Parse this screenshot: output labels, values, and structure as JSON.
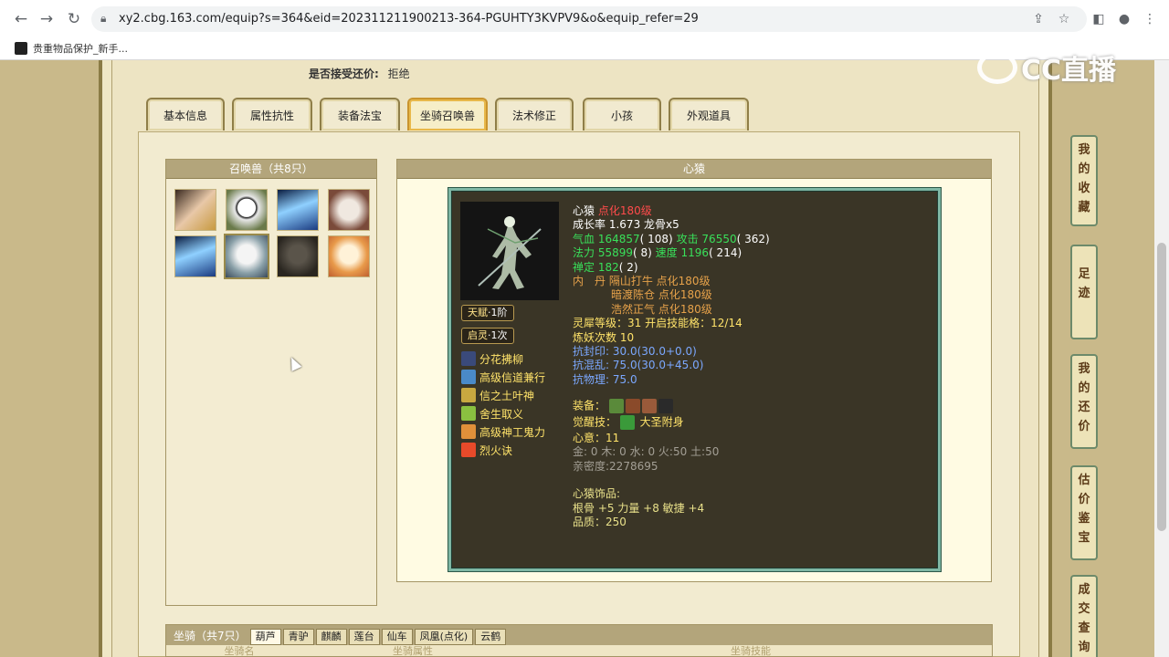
{
  "browser": {
    "url": "xy2.cbg.163.com/equip?s=364&eid=202311211900213-364-PGUHTY3KVPV9&o&equip_refer=29",
    "bookmark": "贵重物品保护_新手..."
  },
  "header": {
    "bargain_label": "是否接受还价:",
    "bargain_value": "拒绝"
  },
  "tabs": [
    "基本信息",
    "属性抗性",
    "装备法宝",
    "坐骑召唤兽",
    "法术修正",
    "小孩",
    "外观道具"
  ],
  "pets": {
    "title": "召唤兽（共8只）"
  },
  "detail": {
    "title": "心猿",
    "name": "心猿",
    "name_tag": "点化180级",
    "growth_label": "成长率",
    "growth_value": "1.673",
    "dragon": "龙骨x5",
    "hp_label": "气血",
    "hp_value": "164857",
    "hp_extra": "( 108)",
    "atk_label": "攻击",
    "atk_value": "76550",
    "atk_extra": "( 362)",
    "mp_label": "法力",
    "mp_value": "55899",
    "mp_extra": "( 8)",
    "spd_label": "速度",
    "spd_value": "1196",
    "spd_extra": "( 214)",
    "zen_label": "禅定",
    "zen_value": "182",
    "zen_extra": "( 2)",
    "neidan_label": "内　丹",
    "neidan": [
      "隔山打牛 点化180级",
      "暗渡陈仓 点化180级",
      "浩然正气 点化180级"
    ],
    "soul_label": "灵犀等级：",
    "soul_value": "31",
    "soul_skill_label": "开启技能格：",
    "soul_skill_value": "12/14",
    "refine_label": "炼妖次数",
    "refine_value": "10",
    "res_seal_label": "抗封印:",
    "res_seal_value": "30.0(30.0+0.0)",
    "res_chaos_label": "抗混乱:",
    "res_chaos_value": "75.0(30.0+45.0)",
    "res_phys_label": "抗物理:",
    "res_phys_value": "75.0",
    "equip_label": "装备：",
    "awaken_label": "觉醒技：",
    "awaken_value": "大圣附身",
    "mind_label": "心意：",
    "mind_value": "11",
    "elements": "金: 0 木: 0 水: 0 火:50 土:50",
    "intimacy": "亲密度:2278695",
    "ornament_title": "心猿饰品:",
    "ornament_stats": "根骨 +5 力量 +8 敏捷 +4",
    "ornament_quality": "品质：250"
  },
  "badges": [
    {
      "label": "天赋",
      "value": "·1阶"
    },
    {
      "label": "启灵",
      "value": "·1次"
    }
  ],
  "skills": [
    "分花拂柳",
    "高级信道兼行",
    "信之土叶神",
    "舍生取义",
    "高级神工鬼力",
    "烈火诀"
  ],
  "mount": {
    "title": "坐骑（共7只）",
    "tabs": [
      "葫芦",
      "青驴",
      "麒麟",
      "莲台",
      "仙车",
      "凤凰(点化)",
      "云鹤"
    ],
    "columns": [
      "坐骑名",
      "坐骑属性",
      "坐骑技能"
    ]
  },
  "sidebar": [
    "我的收藏",
    "足迹",
    "我的还价",
    "估价鉴宝",
    "成交查询"
  ],
  "watermark": "CC直播"
}
